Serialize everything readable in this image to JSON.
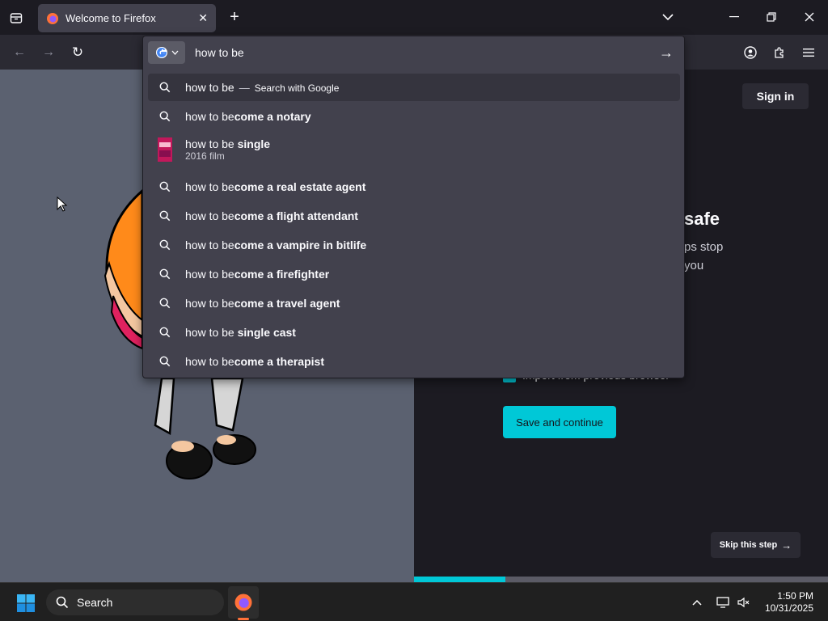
{
  "tab": {
    "title": "Welcome to Firefox"
  },
  "urlbar": {
    "value": "how to be"
  },
  "suggestions": [
    {
      "typed": "how to be",
      "rest": "",
      "hint": "Search with Google"
    },
    {
      "typed": "how to be",
      "rest": "come a notary"
    },
    {
      "typed": "how to be",
      "rest": " single",
      "sub": "2016 film"
    },
    {
      "typed": "how to be",
      "rest": "come a real estate agent"
    },
    {
      "typed": "how to be",
      "rest": "come a flight attendant"
    },
    {
      "typed": "how to be",
      "rest": "come a vampire in bitlife"
    },
    {
      "typed": "how to be",
      "rest": "come a firefighter"
    },
    {
      "typed": "how to be",
      "rest": "come a travel agent"
    },
    {
      "typed": "how to be",
      "rest": " single cast"
    },
    {
      "typed": "how to be",
      "rest": "come a therapist"
    }
  ],
  "page": {
    "signin_label": "Sign in",
    "heading_partial": "safe",
    "sub_line1": "ps stop",
    "sub_line2": "you",
    "import_label": "Import from previous browser",
    "save_label": "Save and continue",
    "skip_label": "Skip this step",
    "progress": 0.22
  },
  "taskbar": {
    "search_label": "Search",
    "time": "1:50 PM",
    "date": "10/31/2025"
  },
  "colors": {
    "accent": "#00c8d7",
    "illustration_bg": "#5b6170"
  }
}
